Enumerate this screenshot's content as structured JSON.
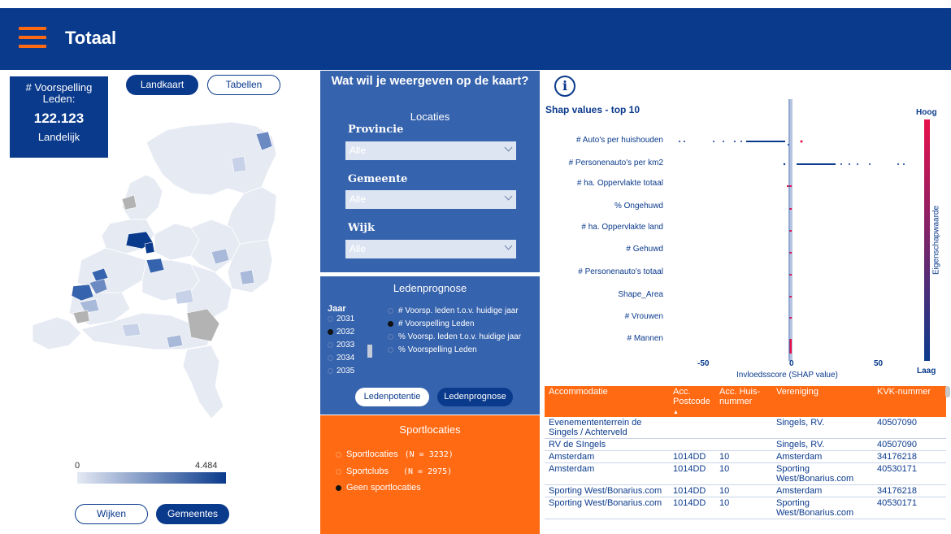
{
  "header": {
    "title": "Totaal"
  },
  "stat": {
    "label": "# Voorspelling Leden:",
    "value": "122.123",
    "sub": "Landelijk"
  },
  "view_toggle": {
    "map": "Landkaart",
    "tables": "Tabellen"
  },
  "map_legend": {
    "min": "0",
    "max": "4.484"
  },
  "region_toggle": {
    "wijken": "Wijken",
    "gemeentes": "Gemeentes"
  },
  "filters": {
    "title": "Wat wil je weergeven op de kaart?",
    "section": "Locaties",
    "provincie": {
      "label": "Provincie",
      "value": "Alle"
    },
    "gemeente": {
      "label": "Gemeente",
      "value": "Alle"
    },
    "wijk": {
      "label": "Wijk",
      "value": "Alle"
    }
  },
  "prognose": {
    "title": "Ledenprognose",
    "jaar_label": "Jaar",
    "years": [
      "2031",
      "2032",
      "2033",
      "2034",
      "2035"
    ],
    "selected_year": "2032",
    "options": [
      "# Voorsp. leden t.o.v. huidige jaar",
      "# Voorspelling Leden",
      "% Voorsp. leden t.o.v. huidige jaar",
      "% Voorspelling Leden"
    ],
    "selected_option": "# Voorspelling Leden",
    "btn_potentie": "Ledenpotentie",
    "btn_prognose": "Ledenprognose"
  },
  "sport": {
    "title": "Sportlocaties",
    "options": [
      {
        "label": "Sportlocaties",
        "count": "(N = 3232)"
      },
      {
        "label": "Sportclubs",
        "count": "(N = 2975)"
      },
      {
        "label": "Geen sportlocaties",
        "count": ""
      }
    ],
    "selected": "Geen sportlocaties"
  },
  "shap": {
    "title": "Shap values - top 10",
    "features": [
      "# Auto's per huishouden",
      "# Personenauto's per km2",
      "# ha. Oppervlakte totaal",
      "% Ongehuwd",
      "# ha. Oppervlakte land",
      "# Gehuwd",
      "# Personenauto's totaal",
      "Shape_Area",
      "# Vrouwen",
      "# Mannen"
    ],
    "xticks": [
      "-50",
      "0",
      "50"
    ],
    "xlabel": "Invloedsscore (SHAP value)",
    "colorbar": {
      "high": "Hoog",
      "low": "Laag",
      "label": "Eigenschapwaarde",
      "high_color": "#e8104a",
      "low_color": "#0a3a8c"
    }
  },
  "table": {
    "headers": [
      "Accommodatie",
      "Acc. Postcode",
      "Acc. Huis-nummer",
      "Vereniging",
      "KVK-nummer"
    ],
    "rows": [
      [
        "Evenemententerrein de Singels / Achterveld",
        "",
        "",
        "Singels, RV.",
        "40507090"
      ],
      [
        "RV de SIngels",
        "",
        "",
        "Singels, RV.",
        "40507090"
      ],
      [
        "Amsterdam",
        "1014DD",
        "10",
        "Amsterdam",
        "34176218"
      ],
      [
        "Amsterdam",
        "1014DD",
        "10",
        "Sporting West/Bonarius.com",
        "40530171"
      ],
      [
        "Sporting West/Bonarius.com",
        "1014DD",
        "10",
        "Amsterdam",
        "34176218"
      ],
      [
        "Sporting West/Bonarius.com",
        "1014DD",
        "10",
        "Sporting West/Bonarius.com",
        "40530171"
      ]
    ]
  },
  "colors": {
    "brand_blue": "#0a3a8c",
    "accent_orange": "#ff6a13",
    "panel_blue": "#3663ad"
  }
}
